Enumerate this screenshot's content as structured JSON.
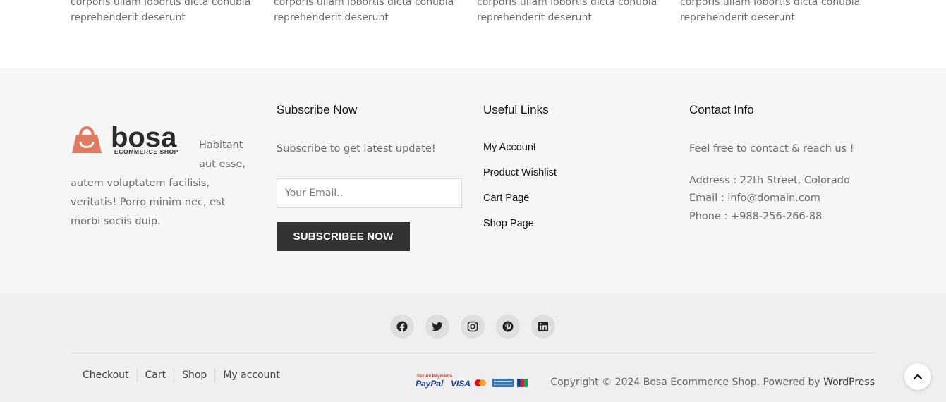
{
  "posts": [
    {
      "line1": "corporis ullam lobortis dicta conubia",
      "line2": "reprehenderit deserunt"
    },
    {
      "line1": "corporis ullam lobortis dicta conubia",
      "line2": "reprehenderit deserunt"
    },
    {
      "line1": "corporis ullam lobortis dicta conubia",
      "line2": "reprehenderit deserunt"
    },
    {
      "line1": "corporis ullam lobortis dicta conubia",
      "line2": "reprehenderit deserunt"
    }
  ],
  "logo": {
    "word": "bosa",
    "tagline": "ECOMMERCE SHOP",
    "accent": "#e07b62"
  },
  "about": {
    "text": "Habitant aut esse, autem voluptatem facilisis, veritatis! Porro minim nec, est morbi sociis duip."
  },
  "subscribe": {
    "title": "Subscribe Now",
    "text": "Subscribe to get latest update!",
    "placeholder": "Your Email..",
    "button": "SUBSCRIBEE NOW"
  },
  "useful_links": {
    "title": "Useful Links",
    "items": [
      "My Account",
      "Product Wishlist",
      "Cart Page",
      "Shop Page"
    ]
  },
  "contact": {
    "title": "Contact Info",
    "intro": "Feel free to contact & reach us !",
    "address": "Address : 22th Street, Colorado",
    "email": "Email : info@domain.com",
    "phone": "Phone : +988-256-266-88"
  },
  "socials": [
    "facebook-icon",
    "twitter-icon",
    "instagram-icon",
    "pinterest-icon",
    "linkedin-icon"
  ],
  "footer_nav": [
    "Checkout",
    "Cart",
    "Shop",
    "My account"
  ],
  "payments": {
    "caption": "Secure Payments",
    "brands": [
      "PayPal",
      "VISA"
    ]
  },
  "copyright": {
    "text": "Copyright © 2024 Bosa Ecommerce Shop. Powered by",
    "link": "WordPress"
  }
}
